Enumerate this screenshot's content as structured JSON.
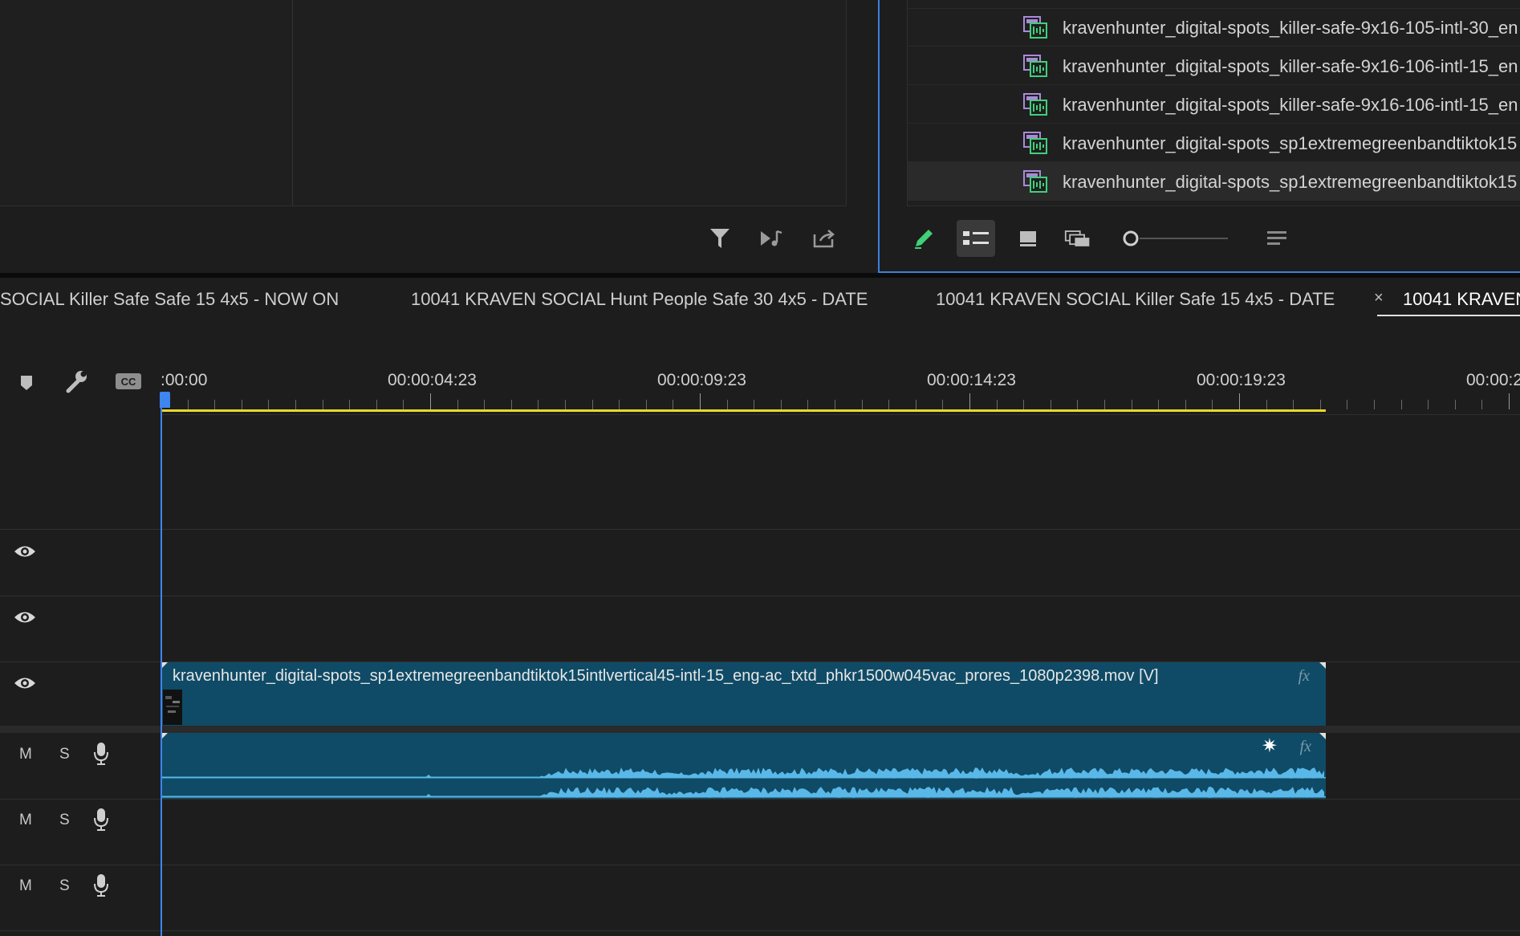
{
  "project_panel": {
    "files": [
      "kravenhunter_digital-spots_killer-safe-9x16-105-intl-30_en",
      "kravenhunter_digital-spots_killer-safe-9x16-106-intl-15_en",
      "kravenhunter_digital-spots_killer-safe-9x16-106-intl-15_en",
      "kravenhunter_digital-spots_sp1extremegreenbandtiktok15",
      "kravenhunter_digital-spots_sp1extremegreenbandtiktok15"
    ]
  },
  "source_toolbar": {
    "icons": [
      "filter-icon",
      "insert-audio-icon",
      "export-icon"
    ]
  },
  "project_toolbar": {
    "icons": [
      "pencil-icon",
      "list-view-icon",
      "icon-view-icon",
      "freeform-view-icon",
      "zoom-slider",
      "menu-icon"
    ]
  },
  "sequence_tabs": [
    "SOCIAL Killer Safe Safe 15 4x5 - NOW ON",
    "10041 KRAVEN SOCIAL Hunt People Safe 30 4x5 - DATE",
    "10041 KRAVEN SOCIAL Killer Safe 15 4x5 - DATE",
    "10041 KRAVEN"
  ],
  "active_tab_close": "×",
  "timeline": {
    "ruler_labels": [
      ":00:00",
      "00:00:04:23",
      "00:00:09:23",
      "00:00:14:23",
      "00:00:19:23",
      "00:00:2"
    ],
    "video_clip_label": "kravenhunter_digital-spots_sp1extremegreenbandtiktok15intlvertical45-intl-15_eng-ac_txtd_phkr1500w045vac_prores_1080p2398.mov [V]",
    "fx_label": "fx",
    "audio_tracks": [
      {
        "mute": "M",
        "solo": "S"
      },
      {
        "mute": "M",
        "solo": "S"
      },
      {
        "mute": "M",
        "solo": "S"
      }
    ]
  },
  "colors": {
    "accent_blue": "#3d85f0",
    "work_area_yellow": "#e8d82a",
    "clip_blue": "#0f4b66",
    "waveform": "#5ab8e8",
    "panel_bg": "#1d1d1d"
  }
}
